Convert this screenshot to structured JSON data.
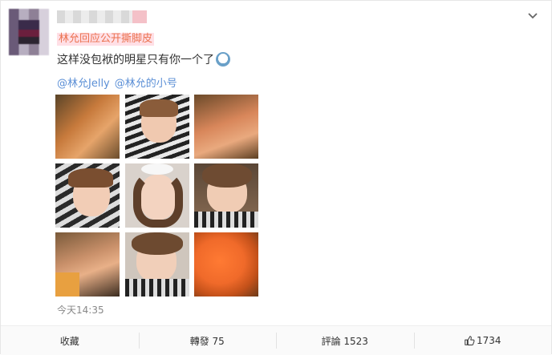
{
  "post": {
    "source_label": "林允回应公开撕脚皮",
    "text": "这样没包袱的明星只有你一个了",
    "mentions": [
      "@林允Jelly",
      "@林允的小号"
    ],
    "time": "今天14:35"
  },
  "icons": {
    "more": "chevron-down-icon",
    "like": "thumbs-up-icon",
    "emoji": "face-emoji-icon"
  },
  "footer": {
    "collect_label": "收藏",
    "repost_label": "轉發 75",
    "comment_label": "評論 1523",
    "like_count": "1734"
  },
  "colors": {
    "accent_orange": "#eb7350",
    "link_blue": "#5b8fd6"
  }
}
